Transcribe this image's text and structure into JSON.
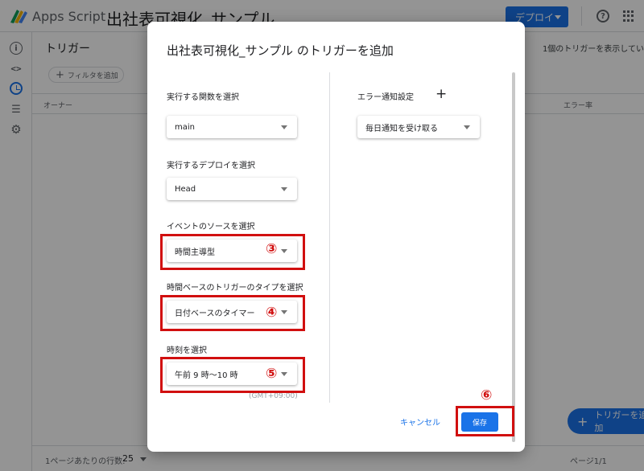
{
  "app": {
    "name": "Apps Script",
    "project_title": "出社表可視化_サンプル",
    "deploy_label": "デプロイ",
    "help_icon": "help-circle-icon",
    "apps_icon": "apps-grid-icon"
  },
  "page": {
    "title": "トリガー",
    "filter_label": "フィルタを追加",
    "count_text": "1個のトリガーを表示してい",
    "columns": {
      "owner": "オーナー",
      "error_rate": "エラー率"
    },
    "add_trigger_label": "トリガーを追加",
    "rows_per_page_label": "1ページあたりの行数:",
    "rows_per_page_value": "25",
    "page_indicator": "ページ1/1"
  },
  "dialog": {
    "title": "出社表可視化_サンプル のトリガーを追加",
    "function_label": "実行する関数を選択",
    "function_value": "main",
    "deploy_label": "実行するデプロイを選択",
    "deploy_value": "Head",
    "event_source_label": "イベントのソースを選択",
    "event_source_value": "時間主導型",
    "trigger_type_label": "時間ベースのトリガーのタイプを選択",
    "trigger_type_value": "日付ベースのタイマー",
    "time_label": "時刻を選択",
    "time_value": "午前 9 時～10 時",
    "timezone": "(GMT+09:00)",
    "error_notify_label": "エラー通知設定",
    "error_notify_value": "毎日通知を受け取る",
    "cancel_label": "キャンセル",
    "save_label": "保存"
  },
  "annotations": {
    "step3": "③",
    "step4": "④",
    "step5": "⑤",
    "step6": "⑥",
    "color": "#d10f0f"
  },
  "colors": {
    "accent": "#1a73e8",
    "annotation_red": "#d10f0f"
  }
}
